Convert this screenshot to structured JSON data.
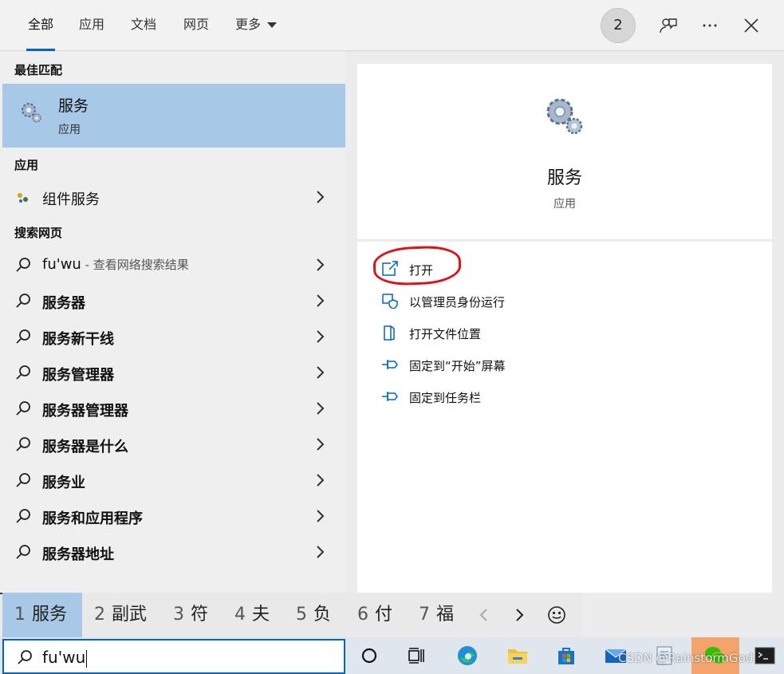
{
  "tabs": [
    {
      "label": "全部",
      "active": true
    },
    {
      "label": "应用"
    },
    {
      "label": "文档"
    },
    {
      "label": "网页"
    },
    {
      "label": "更多"
    }
  ],
  "badge_count": "2",
  "left": {
    "best_match_header": "最佳匹配",
    "best_match": {
      "title": "服务",
      "subtitle": "应用"
    },
    "apps_header": "应用",
    "apps": [
      {
        "label": "组件服务"
      }
    ],
    "web_header": "搜索网页",
    "web_first": {
      "query": "fu'wu",
      "suffix": " - 查看网络搜索结果"
    },
    "web_results": [
      "服务器",
      "服务新干线",
      "服务管理器",
      "服务器管理器",
      "服务器是什么",
      "服务业",
      "服务和应用程序",
      "服务器地址"
    ]
  },
  "right": {
    "app_title": "服务",
    "app_subtitle": "应用",
    "actions": [
      "打开",
      "以管理员身份运行",
      "打开文件位置",
      "固定到“开始”屏幕",
      "固定到任务栏"
    ]
  },
  "ime": {
    "candidates": [
      {
        "num": "1",
        "text": "服务",
        "selected": true
      },
      {
        "num": "2",
        "text": "副武"
      },
      {
        "num": "3",
        "text": "符"
      },
      {
        "num": "4",
        "text": "夫"
      },
      {
        "num": "5",
        "text": "负"
      },
      {
        "num": "6",
        "text": "付"
      },
      {
        "num": "7",
        "text": "福"
      }
    ]
  },
  "taskbar": {
    "search_value": "fu'wu",
    "watermark": "CSDN @RainstormGod"
  },
  "colors": {
    "accent": "#0067c0",
    "selection": "#a7c8e6",
    "annotation": "#e0101b"
  }
}
